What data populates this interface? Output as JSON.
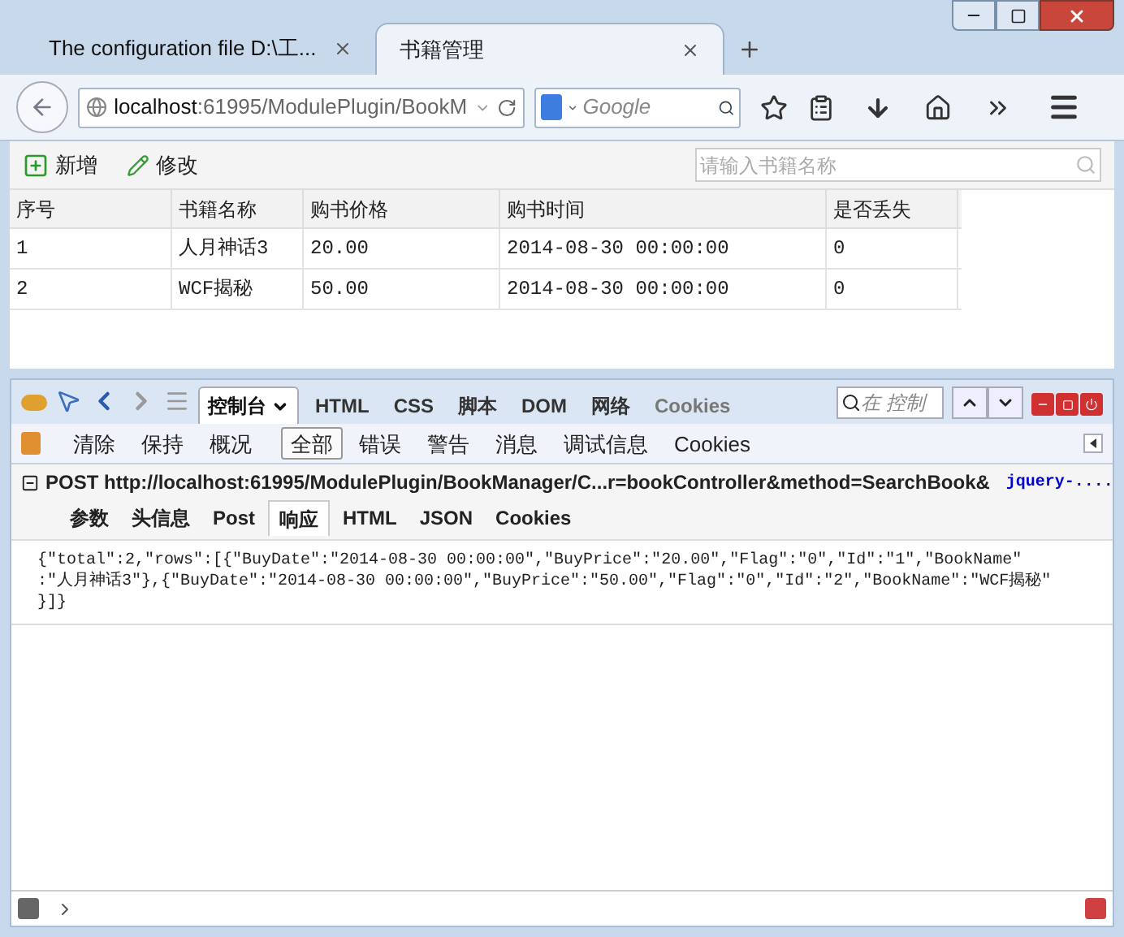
{
  "tabs": [
    {
      "title": "The configuration file D:\\工...",
      "selected": false
    },
    {
      "title": "书籍管理",
      "selected": true
    }
  ],
  "address": {
    "host": "localhost",
    "path": ":61995/ModulePlugin/BookM"
  },
  "web_search": {
    "placeholder": "Google"
  },
  "page_toolbar": {
    "buttons": [
      {
        "kind": "add",
        "label": "新增"
      },
      {
        "kind": "edit",
        "label": "修改"
      }
    ],
    "search_placeholder": "请输入书籍名称"
  },
  "table": {
    "columns": [
      "序号",
      "书籍名称",
      "购书价格",
      "购书时间",
      "是否丢失"
    ],
    "rows": [
      [
        "1",
        "人月神话3",
        "20.00",
        "2014-08-30 00:00:00",
        "0"
      ],
      [
        "2",
        "WCF揭秘",
        "50.00",
        "2014-08-30 00:00:00",
        "0"
      ]
    ]
  },
  "devtools": {
    "panels": [
      {
        "label": "控制台",
        "selected": true
      },
      {
        "label": "HTML",
        "selected": false
      },
      {
        "label": "CSS",
        "selected": false
      },
      {
        "label": "脚本",
        "selected": false
      },
      {
        "label": "DOM",
        "selected": false
      },
      {
        "label": "网络",
        "selected": false
      },
      {
        "label": "Cookies",
        "selected": false
      }
    ],
    "search_placeholder": "在 控制",
    "filters": [
      {
        "label": "清除",
        "kind": "action",
        "selected": false
      },
      {
        "label": "保持",
        "kind": "action",
        "selected": false
      },
      {
        "label": "概况",
        "kind": "action",
        "selected": false
      },
      {
        "label": "全部",
        "kind": "filter",
        "selected": true
      },
      {
        "label": "错误",
        "kind": "filter",
        "selected": false
      },
      {
        "label": "警告",
        "kind": "filter",
        "selected": false
      },
      {
        "label": "消息",
        "kind": "filter",
        "selected": false
      },
      {
        "label": "调试信息",
        "kind": "filter",
        "selected": false
      },
      {
        "label": "Cookies",
        "kind": "filter",
        "selected": false
      }
    ],
    "request": {
      "expanded": true,
      "method": "POST",
      "url": "http://localhost:61995/ModulePlugin/BookManager/C...r=bookController&method=SearchBook&",
      "source": "jquery-....",
      "tabs": [
        {
          "label": "参数",
          "selected": false
        },
        {
          "label": "头信息",
          "selected": false
        },
        {
          "label": "Post",
          "selected": false
        },
        {
          "label": "响应",
          "selected": true
        },
        {
          "label": "HTML",
          "selected": false
        },
        {
          "label": "JSON",
          "selected": false
        },
        {
          "label": "Cookies",
          "selected": false
        }
      ],
      "response_lines": [
        "{\"total\":2,\"rows\":[{\"BuyDate\":\"2014-08-30 00:00:00\",\"BuyPrice\":\"20.00\",\"Flag\":\"0\",\"Id\":\"1\",\"BookName\"",
        ":\"人月神话3\"},{\"BuyDate\":\"2014-08-30 00:00:00\",\"BuyPrice\":\"50.00\",\"Flag\":\"0\",\"Id\":\"2\",\"BookName\":\"WCF揭秘\"",
        "}]}"
      ]
    }
  }
}
